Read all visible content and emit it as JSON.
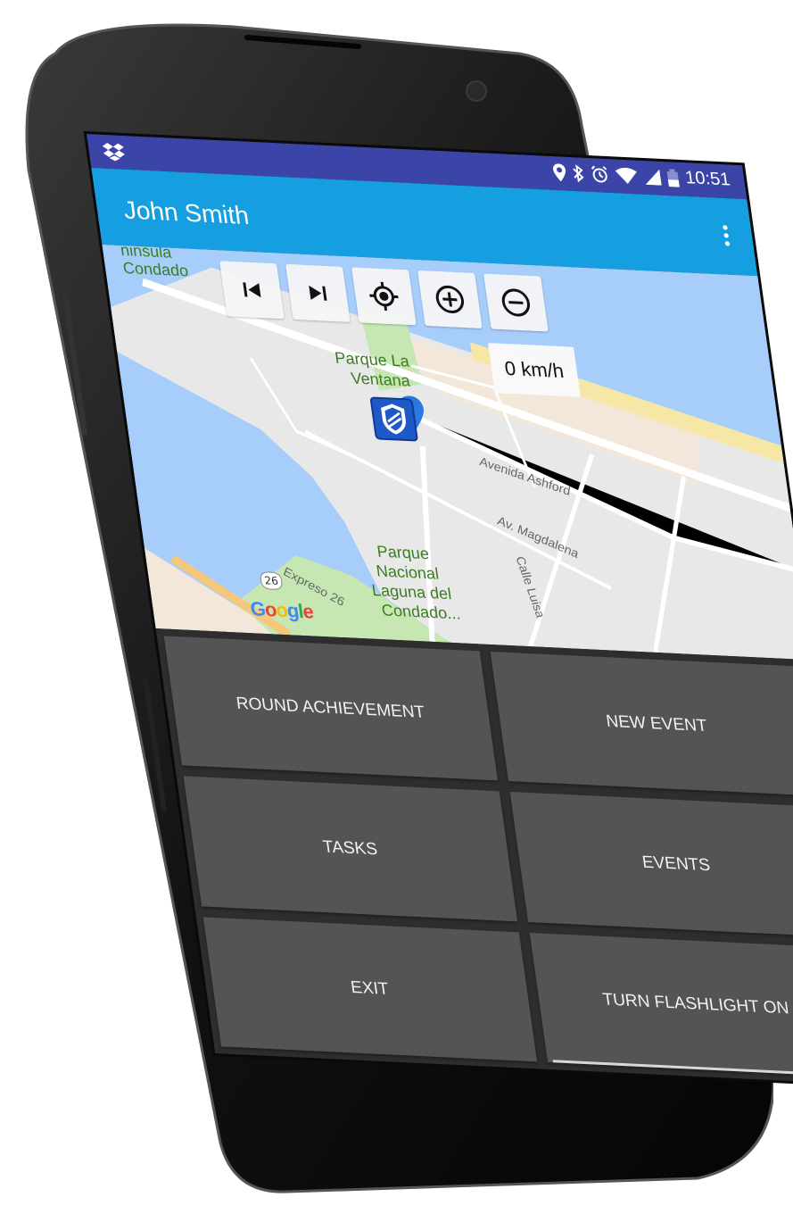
{
  "status_bar": {
    "left_icon": "dropbox-icon",
    "icons": [
      "location-icon",
      "bluetooth-icon",
      "alarm-icon",
      "wifi-icon",
      "signal-icon",
      "battery-icon"
    ],
    "time": "10:51"
  },
  "app_bar": {
    "title": "John Smith",
    "overflow_icon": "more-vert-icon"
  },
  "map": {
    "controls": [
      "skip-previous-icon",
      "skip-next-icon",
      "my-location-icon",
      "zoom-in-icon",
      "zoom-out-icon"
    ],
    "speed": "0 km/h",
    "labels": {
      "peninsula": "ninsula",
      "condado": "Condado",
      "parque_ventana_1": "Parque La",
      "parque_ventana_2": "Ventana",
      "avenida_ashford": "Avenida Ashford",
      "av_magdalena": "Av. Magdalena",
      "calle_luisa": "Calle Luisa",
      "parque_nacional_1": "Parque",
      "parque_nacional_2": "Nacional",
      "parque_nacional_3": "Laguna del",
      "parque_nacional_4": "Condado...",
      "expreso": "Expreso 26",
      "route_number": "26",
      "google": "Google"
    },
    "marker_icon": "shield-marker-icon"
  },
  "buttons": {
    "round_achievement": "ROUND ACHIEVEMENT",
    "new_event": "NEW EVENT",
    "tasks": "TASKS",
    "events": "EVENTS",
    "exit": "EXIT",
    "flashlight": "TURN FLASHLIGHT ON"
  },
  "colors": {
    "status_bar": "#3b45a8",
    "app_bar": "#169fe0",
    "button_bg": "#545454",
    "grid_bg": "#2e2e2e"
  }
}
